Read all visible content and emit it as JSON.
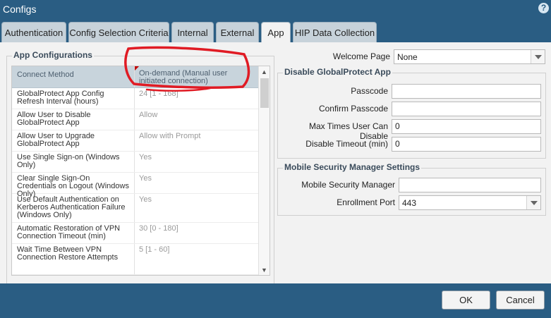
{
  "window": {
    "title": "Configs",
    "help_icon": "?"
  },
  "tabs": [
    {
      "label": "Authentication"
    },
    {
      "label": "Config Selection Criteria"
    },
    {
      "label": "Internal"
    },
    {
      "label": "External"
    },
    {
      "label": "App",
      "active": true
    },
    {
      "label": "HIP Data Collection"
    }
  ],
  "app_config": {
    "legend": "App Configurations",
    "header": {
      "name": "Connect Method",
      "value": "On-demand (Manual user initiated connection)"
    },
    "rows": [
      {
        "name": "GlobalProtect App Config Refresh Interval (hours)",
        "value": "24 [1 - 168]"
      },
      {
        "name": "Allow User to Disable GlobalProtect App",
        "value": "Allow"
      },
      {
        "name": "Allow User to Upgrade GlobalProtect App",
        "value": "Allow with Prompt"
      },
      {
        "name": "Use Single Sign-on (Windows Only)",
        "value": "Yes"
      },
      {
        "name": "Clear Single Sign-On Credentials on Logout (Windows Only)",
        "value": "Yes"
      },
      {
        "name": "Use Default Authentication on Kerberos Authentication Failure (Windows Only)",
        "value": "Yes"
      },
      {
        "name": "Automatic Restoration of VPN Connection Timeout (min)",
        "value": "30 [0 - 180]"
      },
      {
        "name": "Wait Time Between VPN Connection Restore Attempts",
        "value": "5 [1 - 60]"
      }
    ]
  },
  "welcome_page": {
    "label": "Welcome Page",
    "value": "None"
  },
  "disable_app": {
    "legend": "Disable GlobalProtect App",
    "passcode_label": "Passcode",
    "passcode_value": "",
    "confirm_label": "Confirm Passcode",
    "confirm_value": "",
    "max_times_label": "Max Times User Can Disable",
    "max_times_value": "0",
    "timeout_label": "Disable Timeout (min)",
    "timeout_value": "0"
  },
  "mobile_security": {
    "legend": "Mobile Security Manager Settings",
    "manager_label": "Mobile Security Manager",
    "manager_value": "",
    "port_label": "Enrollment Port",
    "port_value": "443"
  },
  "footer": {
    "ok_label": "OK",
    "cancel_label": "Cancel"
  },
  "annotation_color": "#e01b24"
}
